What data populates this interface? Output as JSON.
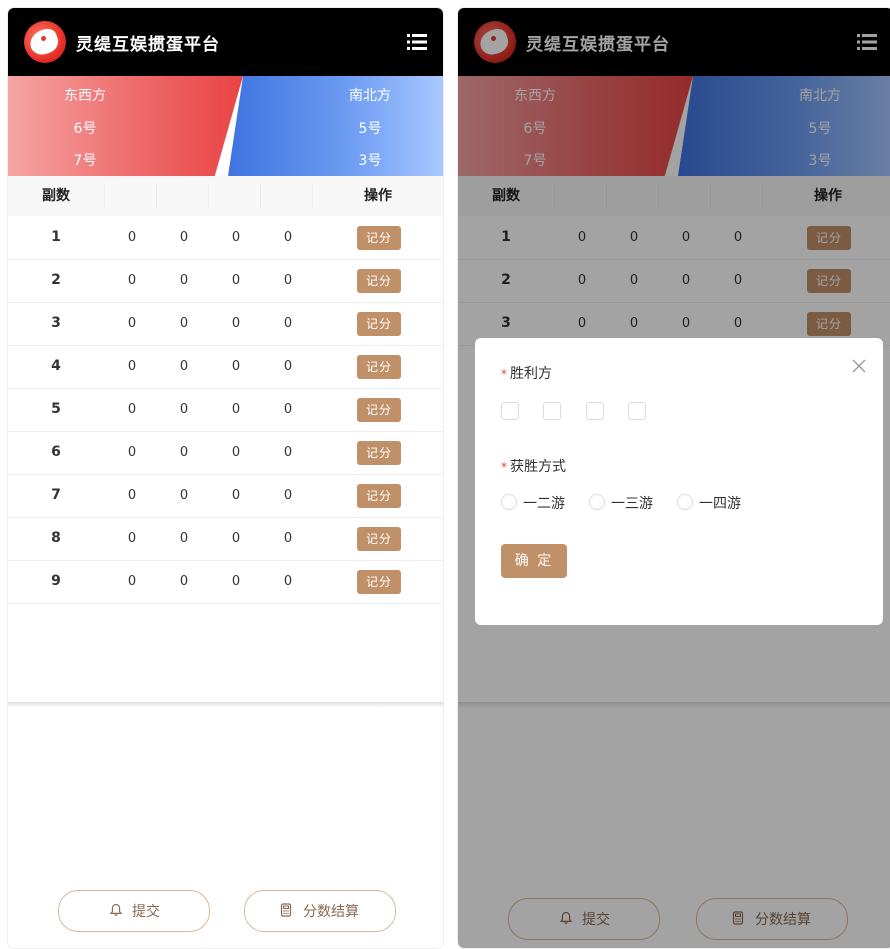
{
  "app": {
    "title": "灵缇互娱掼蛋平台"
  },
  "teams": {
    "east_west": {
      "name": "东西方",
      "player1": "6号",
      "player2": "7号"
    },
    "north_south": {
      "name": "南北方",
      "player1": "5号",
      "player2": "3号"
    }
  },
  "table": {
    "col_round": "副数",
    "col_action": "操作",
    "score_button_label": "记分",
    "rows": [
      {
        "round": "1",
        "scores": [
          "0",
          "0",
          "0",
          "0"
        ]
      },
      {
        "round": "2",
        "scores": [
          "0",
          "0",
          "0",
          "0"
        ]
      },
      {
        "round": "3",
        "scores": [
          "0",
          "0",
          "0",
          "0"
        ]
      },
      {
        "round": "4",
        "scores": [
          "0",
          "0",
          "0",
          "0"
        ]
      },
      {
        "round": "5",
        "scores": [
          "0",
          "0",
          "0",
          "0"
        ]
      },
      {
        "round": "6",
        "scores": [
          "0",
          "0",
          "0",
          "0"
        ]
      },
      {
        "round": "7",
        "scores": [
          "0",
          "0",
          "0",
          "0"
        ]
      },
      {
        "round": "8",
        "scores": [
          "0",
          "0",
          "0",
          "0"
        ]
      },
      {
        "round": "9",
        "scores": [
          "0",
          "0",
          "0",
          "0"
        ]
      }
    ]
  },
  "actions": {
    "submit_label": "提交",
    "settle_label": "分数结算"
  },
  "modal": {
    "required_mark": "*",
    "winner_label": "胜利方",
    "win_method_label": "获胜方式",
    "win_methods": [
      "一二游",
      "一三游",
      "一四游"
    ],
    "confirm_label": "确 定"
  },
  "icons": {
    "menu": "menu-icon",
    "bell": "bell-icon",
    "calculator": "calculator-icon",
    "close": "close-icon"
  },
  "colors": {
    "accent": "#c09068",
    "team_east_west": "#e94444",
    "team_north_south": "#3f73e0",
    "header": "#000000"
  }
}
